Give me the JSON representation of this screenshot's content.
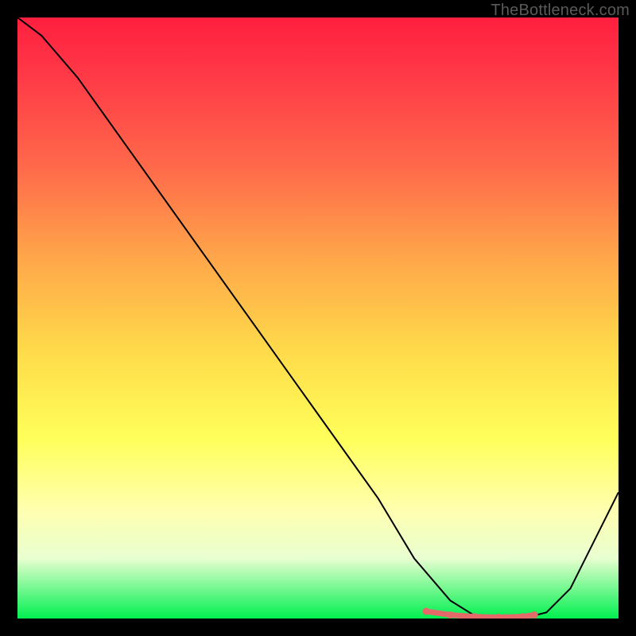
{
  "watermark": "TheBottleneck.com",
  "chart_data": {
    "type": "line",
    "title": "",
    "xlabel": "",
    "ylabel": "",
    "xlim": [
      0,
      100
    ],
    "ylim": [
      0,
      100
    ],
    "grid": false,
    "series": [
      {
        "name": "curve",
        "color": "#000000",
        "x": [
          0,
          4,
          10,
          20,
          30,
          40,
          50,
          60,
          66,
          72,
          76,
          80,
          84,
          88,
          92,
          100
        ],
        "y": [
          100,
          97,
          90,
          76,
          62,
          48,
          34,
          20,
          10,
          3,
          0.5,
          0,
          0,
          1,
          5,
          21
        ]
      }
    ],
    "markers": {
      "name": "highlight",
      "color": "#e46a6a",
      "x": [
        68,
        72,
        76,
        80,
        84,
        86
      ],
      "y": [
        1.2,
        0.6,
        0.3,
        0.2,
        0.3,
        0.6
      ]
    },
    "background_gradient": {
      "top": "#ff1f3f",
      "bottom": "#00f050",
      "stops": [
        "red",
        "orange",
        "yellow",
        "green"
      ]
    }
  }
}
